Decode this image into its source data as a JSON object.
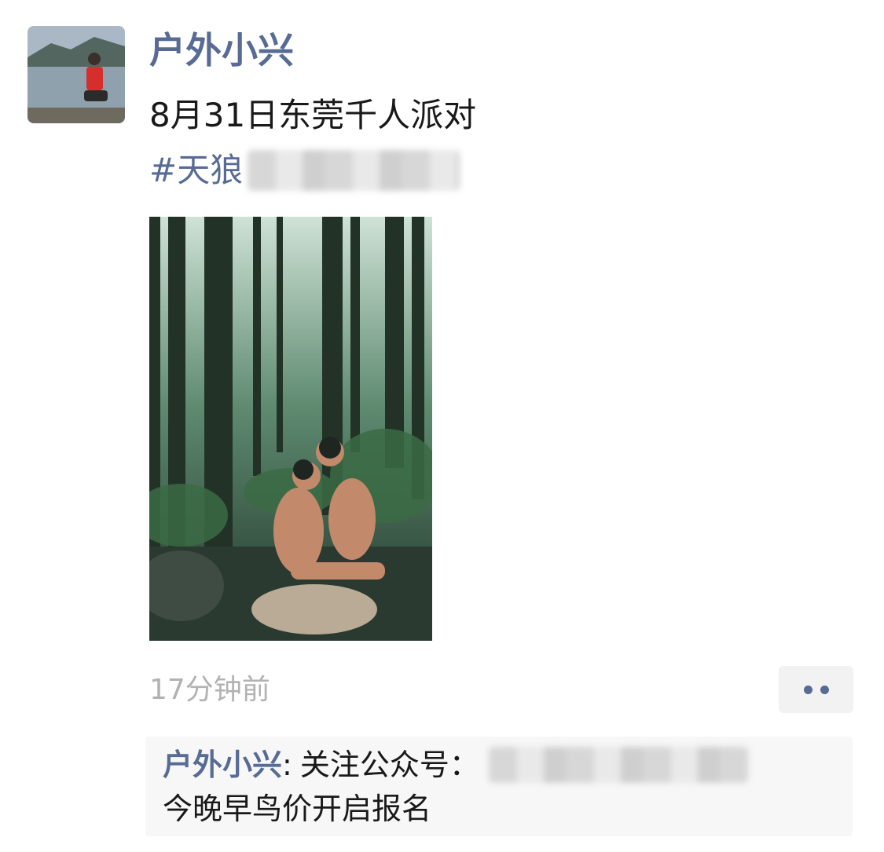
{
  "post": {
    "author": "户外小兴",
    "avatar_icon": "user-avatar-photo",
    "text_line1": "8月31日东莞千人派对",
    "hashtag_visible": "#天狼",
    "photo": "post-photo-forest",
    "timestamp": "17分钟前",
    "more_icon": "more-dots-icon"
  },
  "comments": [
    {
      "author": "户外小兴",
      "separator": ":",
      "text_line1": "关注公众号：",
      "text_line2": "今晚早鸟价开启报名"
    }
  ],
  "colors": {
    "link": "#576b95",
    "text": "#191919",
    "timestamp": "#b2b2b2",
    "comment_bg": "#f7f7f7"
  }
}
